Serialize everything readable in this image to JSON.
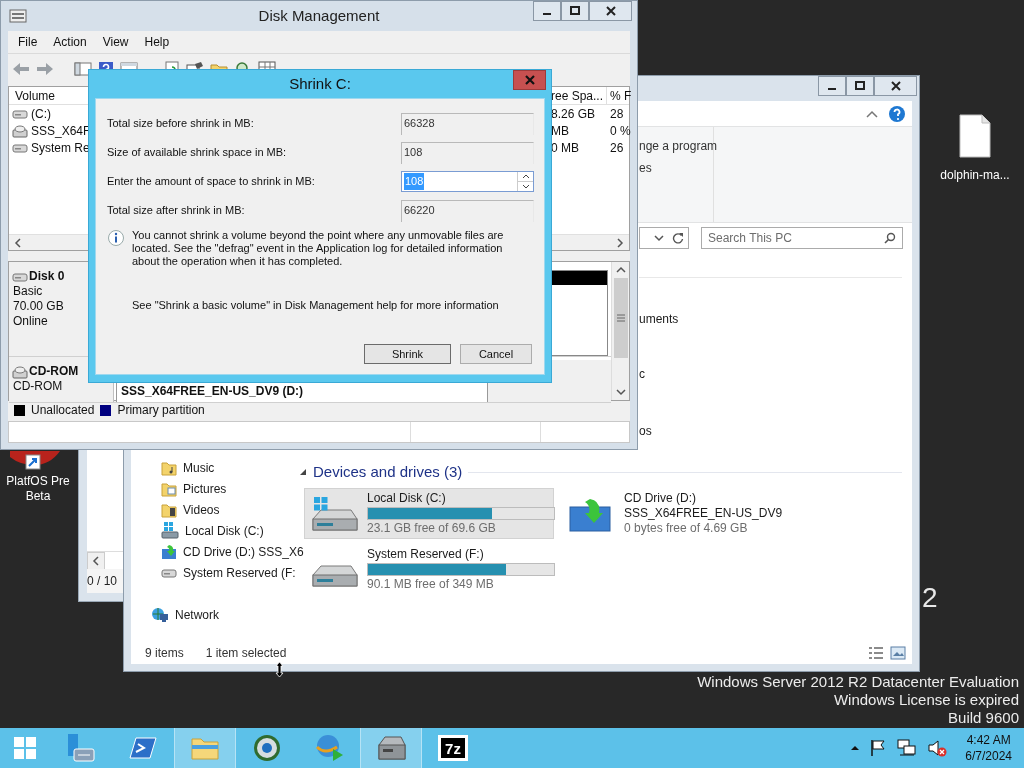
{
  "desktop": {
    "icons": [
      {
        "label": "dolphin-ma...",
        "kind": "file"
      },
      {
        "label": "PlatfOS Pre Beta",
        "kind": "app"
      }
    ],
    "branding": "2",
    "watermark": [
      "Windows Server 2012 R2 Datacenter Evaluation",
      "Windows License is expired",
      "Build 9600"
    ]
  },
  "back_window": {
    "status": "0 / 10"
  },
  "explorer": {
    "ribbon_texts": [
      "nge a program",
      "es"
    ],
    "search": {
      "placeholder": "Search This PC"
    },
    "folder_fragments": [
      "uments",
      "c",
      "os"
    ],
    "nav": [
      {
        "label": "Music",
        "kind": "music"
      },
      {
        "label": "Pictures",
        "kind": "pictures"
      },
      {
        "label": "Videos",
        "kind": "videos"
      },
      {
        "label": "Local Disk (C:)",
        "kind": "windows-drive"
      },
      {
        "label": "CD Drive (D:) SSS_X6",
        "kind": "cd"
      },
      {
        "label": "System Reserved (F:",
        "kind": "drive"
      }
    ],
    "network": "Network",
    "group": "Devices and drives (3)",
    "drives": [
      {
        "name": "Local Disk (C:)",
        "kind": "windows-drive",
        "free": "23.1 GB free of 69.6 GB",
        "level": 0.668,
        "selected": true
      },
      {
        "name": "CD Drive (D:)",
        "label": "SSS_X64FREE_EN-US_DV9",
        "kind": "cd",
        "free": "0 bytes free of 4.69 GB",
        "selected": false
      },
      {
        "name": "System Reserved (F:)",
        "kind": "drive",
        "free": "90.1 MB free of 349 MB",
        "level": 0.742,
        "selected": false
      }
    ],
    "status": [
      "9 items",
      "1 item selected"
    ]
  },
  "disk_management": {
    "title": "Disk Management",
    "menu": [
      "File",
      "Action",
      "View",
      "Help"
    ],
    "columns": [
      "Volume",
      "ree Spa...",
      "% F"
    ],
    "volumes": [
      {
        "name": "(C:)",
        "kind": "disk",
        "free": "8.26 GB",
        "percent": "28"
      },
      {
        "name": "SSS_X64F",
        "kind": "cd",
        "free": "MB",
        "percent": "0 %"
      },
      {
        "name": "System Re",
        "kind": "disk",
        "free": "0 MB",
        "percent": "26"
      }
    ],
    "disks": [
      {
        "name": "Disk 0",
        "kind": "disk",
        "details": [
          "Basic",
          "70.00 GB",
          "Online"
        ]
      },
      {
        "name": "CD-ROM",
        "kind": "cd",
        "details": [
          "CD-ROM"
        ],
        "partition": "SSS_X64FREE_EN-US_DV9 (D:)"
      }
    ],
    "legend": [
      {
        "label": "Unallocated",
        "color": "#000000"
      },
      {
        "label": "Primary partition",
        "color": "#000080"
      }
    ]
  },
  "shrink_dialog": {
    "title": "Shrink C:",
    "fields": [
      {
        "label": "Total size before shrink in MB:",
        "value": "66328",
        "kind": "readonly",
        "value_selected": false
      },
      {
        "label": "Size of available shrink space in MB:",
        "value": "108",
        "kind": "readonly",
        "value_selected": false
      },
      {
        "label": "Enter the amount of space to shrink in MB:",
        "value": "108",
        "kind": "spin",
        "value_selected": true
      },
      {
        "label": "Total size after shrink in MB:",
        "value": "66220",
        "kind": "readonly",
        "value_selected": false
      }
    ],
    "note": "You cannot shrink a volume beyond the point where any unmovable files are located. See the \"defrag\" event in the Application log for detailed information about the operation when it has completed.",
    "help": "See \"Shrink a basic volume\" in Disk Management help for more information",
    "buttons": [
      "Shrink",
      "Cancel"
    ]
  },
  "taskbar": {
    "apps": [
      {
        "kind": "server-manager",
        "active": false
      },
      {
        "kind": "powershell",
        "active": false
      },
      {
        "kind": "explorer",
        "active": true
      },
      {
        "kind": "globe",
        "active": false
      },
      {
        "kind": "download",
        "active": false
      },
      {
        "kind": "disk",
        "active": true
      },
      {
        "kind": "archiver",
        "active": false,
        "logo_text": "7z"
      }
    ],
    "clock": {
      "time": "4:42 AM",
      "date": "6/7/2024"
    }
  }
}
